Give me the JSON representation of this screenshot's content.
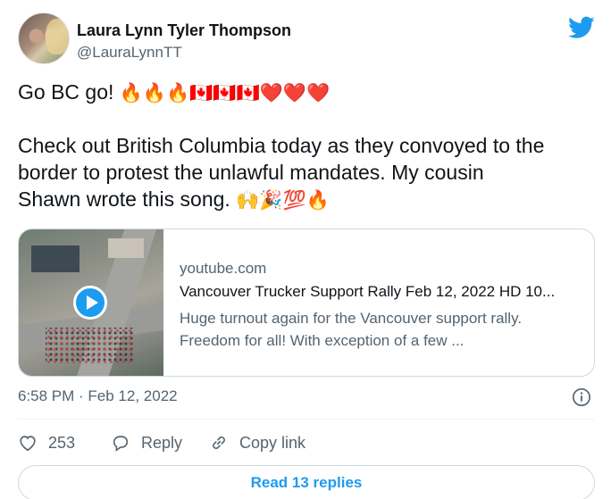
{
  "tweet": {
    "author_name": "Laura Lynn Tyler Thompson",
    "author_handle": "@LauraLynnTT",
    "line1_text": "Go BC go! ",
    "line1_emoji": "🔥🔥🔥🇨🇦🇨🇦🇨🇦❤️❤️❤️",
    "line2": "Check out British Columbia today as they convoyed to the",
    "line3": "border to protest the unlawful mandates.  My cousin",
    "line4_text": "Shawn wrote this song. ",
    "line4_emoji": "🙌🎉💯🔥",
    "timestamp": "6:58 PM · Feb 12, 2022"
  },
  "card": {
    "domain": "youtube.com",
    "title": "Vancouver Trucker Support Rally Feb 12, 2022 HD 10...",
    "description": "Huge turnout again for the Vancouver support rally. Freedom for all! With exception of a few ..."
  },
  "actions": {
    "like_count": "253",
    "reply_label": "Reply",
    "copy_link_label": "Copy link"
  },
  "read_replies_label": "Read 13 replies",
  "icons": [
    "twitter-bird-icon",
    "play-icon",
    "info-icon",
    "heart-icon",
    "reply-bubble-icon",
    "link-icon"
  ],
  "colors": {
    "accent": "#1d9bf0",
    "secondary_text": "#536471",
    "border": "#cfd9de"
  }
}
